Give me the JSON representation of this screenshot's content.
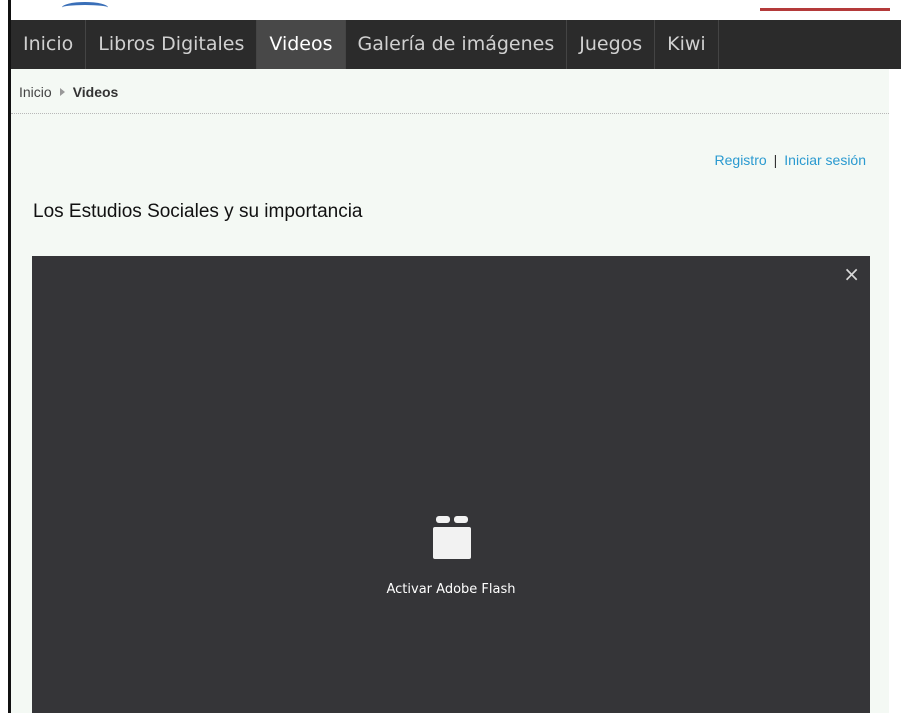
{
  "nav": {
    "items": [
      {
        "label": "Inicio",
        "active": false
      },
      {
        "label": "Libros Digitales",
        "active": false
      },
      {
        "label": "Videos",
        "active": true
      },
      {
        "label": "Galería de imágenes",
        "active": false
      },
      {
        "label": "Juegos",
        "active": false
      },
      {
        "label": "Kiwi",
        "active": false
      }
    ]
  },
  "breadcrumb": {
    "home": "Inicio",
    "current": "Videos"
  },
  "auth": {
    "register": "Registro",
    "separator": "|",
    "login": "Iniciar sesión"
  },
  "page": {
    "title": "Los Estudios Sociales y su importancia"
  },
  "video": {
    "close_symbol": "×",
    "plugin_icon": "plugin-block-icon",
    "activate_label": "Activar Adobe Flash"
  },
  "colors": {
    "nav_bg": "#2b2b2b",
    "nav_active_bg": "#484848",
    "content_bg": "#f4f9f4",
    "link": "#2a9ad0",
    "player_bg": "#353538"
  }
}
